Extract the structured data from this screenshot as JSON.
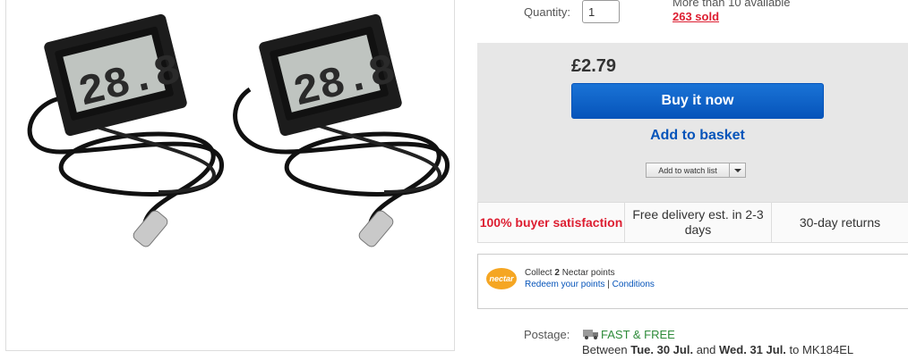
{
  "image_panel": {
    "alt": "Digital LCD thermometer with probe (2 pack)",
    "display_text": "28.8"
  },
  "quantity": {
    "label": "Quantity:",
    "value": "1",
    "availability": "More than 10 available",
    "sold": "263 sold"
  },
  "buy_box": {
    "price": "£2.79",
    "buy_now": "Buy it now",
    "add_to_basket": "Add to basket",
    "watch_list": "Add to watch list"
  },
  "trust": {
    "satisfaction": "100% buyer satisfaction",
    "delivery": "Free delivery est. in 2-3 days",
    "returns": "30-day returns"
  },
  "nectar": {
    "logo": "nectar",
    "collect_prefix": "Collect",
    "collect_points": "2",
    "collect_suffix": "Nectar points",
    "redeem": "Redeem your points",
    "conditions": "Conditions"
  },
  "postage": {
    "label": "Postage:",
    "fast_free": "FAST & FREE",
    "between": "Between",
    "date_from": "Tue. 30 Jul.",
    "and": "and",
    "date_to": "Wed. 31 Jul.",
    "to": "to MK184EL"
  },
  "colors": {
    "accent_blue": "#0654ba",
    "sold_red": "#dd1e31",
    "fast_green": "#2e8b3a",
    "nectar_orange": "#f5a623"
  }
}
